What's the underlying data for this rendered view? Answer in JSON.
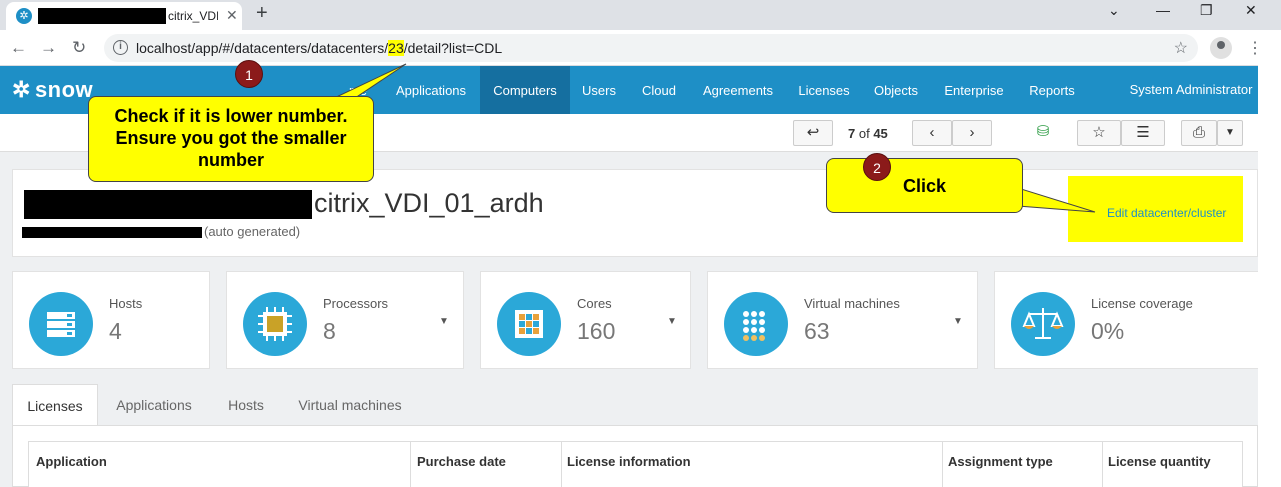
{
  "browser": {
    "tab_title": "citrix_VDI",
    "new_tab": "+",
    "close_tab": "✕",
    "url_prefix": "localhost/app/#/datacenters/datacenters/",
    "url_highlight": "23",
    "url_suffix": "/detail?list=CDL"
  },
  "appnav": {
    "logo": "snow",
    "items": [
      "me",
      "Applications",
      "Computers",
      "Users",
      "Cloud",
      "Agreements",
      "Licenses",
      "Objects",
      "Enterprise",
      "Reports"
    ],
    "user": "System Administrator"
  },
  "toolbar": {
    "current": "7",
    "of": "of",
    "total": "45"
  },
  "header": {
    "title": "citrix_VDI_01_ardh",
    "subtitle": "(auto generated)",
    "edit_link": "Edit datacenter/cluster"
  },
  "stats": [
    {
      "label": "Hosts",
      "value": "4"
    },
    {
      "label": "Processors",
      "value": "8"
    },
    {
      "label": "Cores",
      "value": "160"
    },
    {
      "label": "Virtual machines",
      "value": "63"
    },
    {
      "label": "License coverage",
      "value": "0%"
    }
  ],
  "tabs": [
    "Licenses",
    "Applications",
    "Hosts",
    "Virtual machines"
  ],
  "table": {
    "columns": [
      "Application",
      "Purchase date",
      "License information",
      "Assignment type",
      "License quantity"
    ]
  },
  "callouts": {
    "one_number": "1",
    "one_text": "Check if it is lower number. Ensure you got the smaller number",
    "two_number": "2",
    "two_text": "Click"
  },
  "colors": {
    "brand": "#1e8fc6",
    "active_nav": "#156fa0",
    "highlight": "#ffff00",
    "badge": "#8b1a1a"
  }
}
